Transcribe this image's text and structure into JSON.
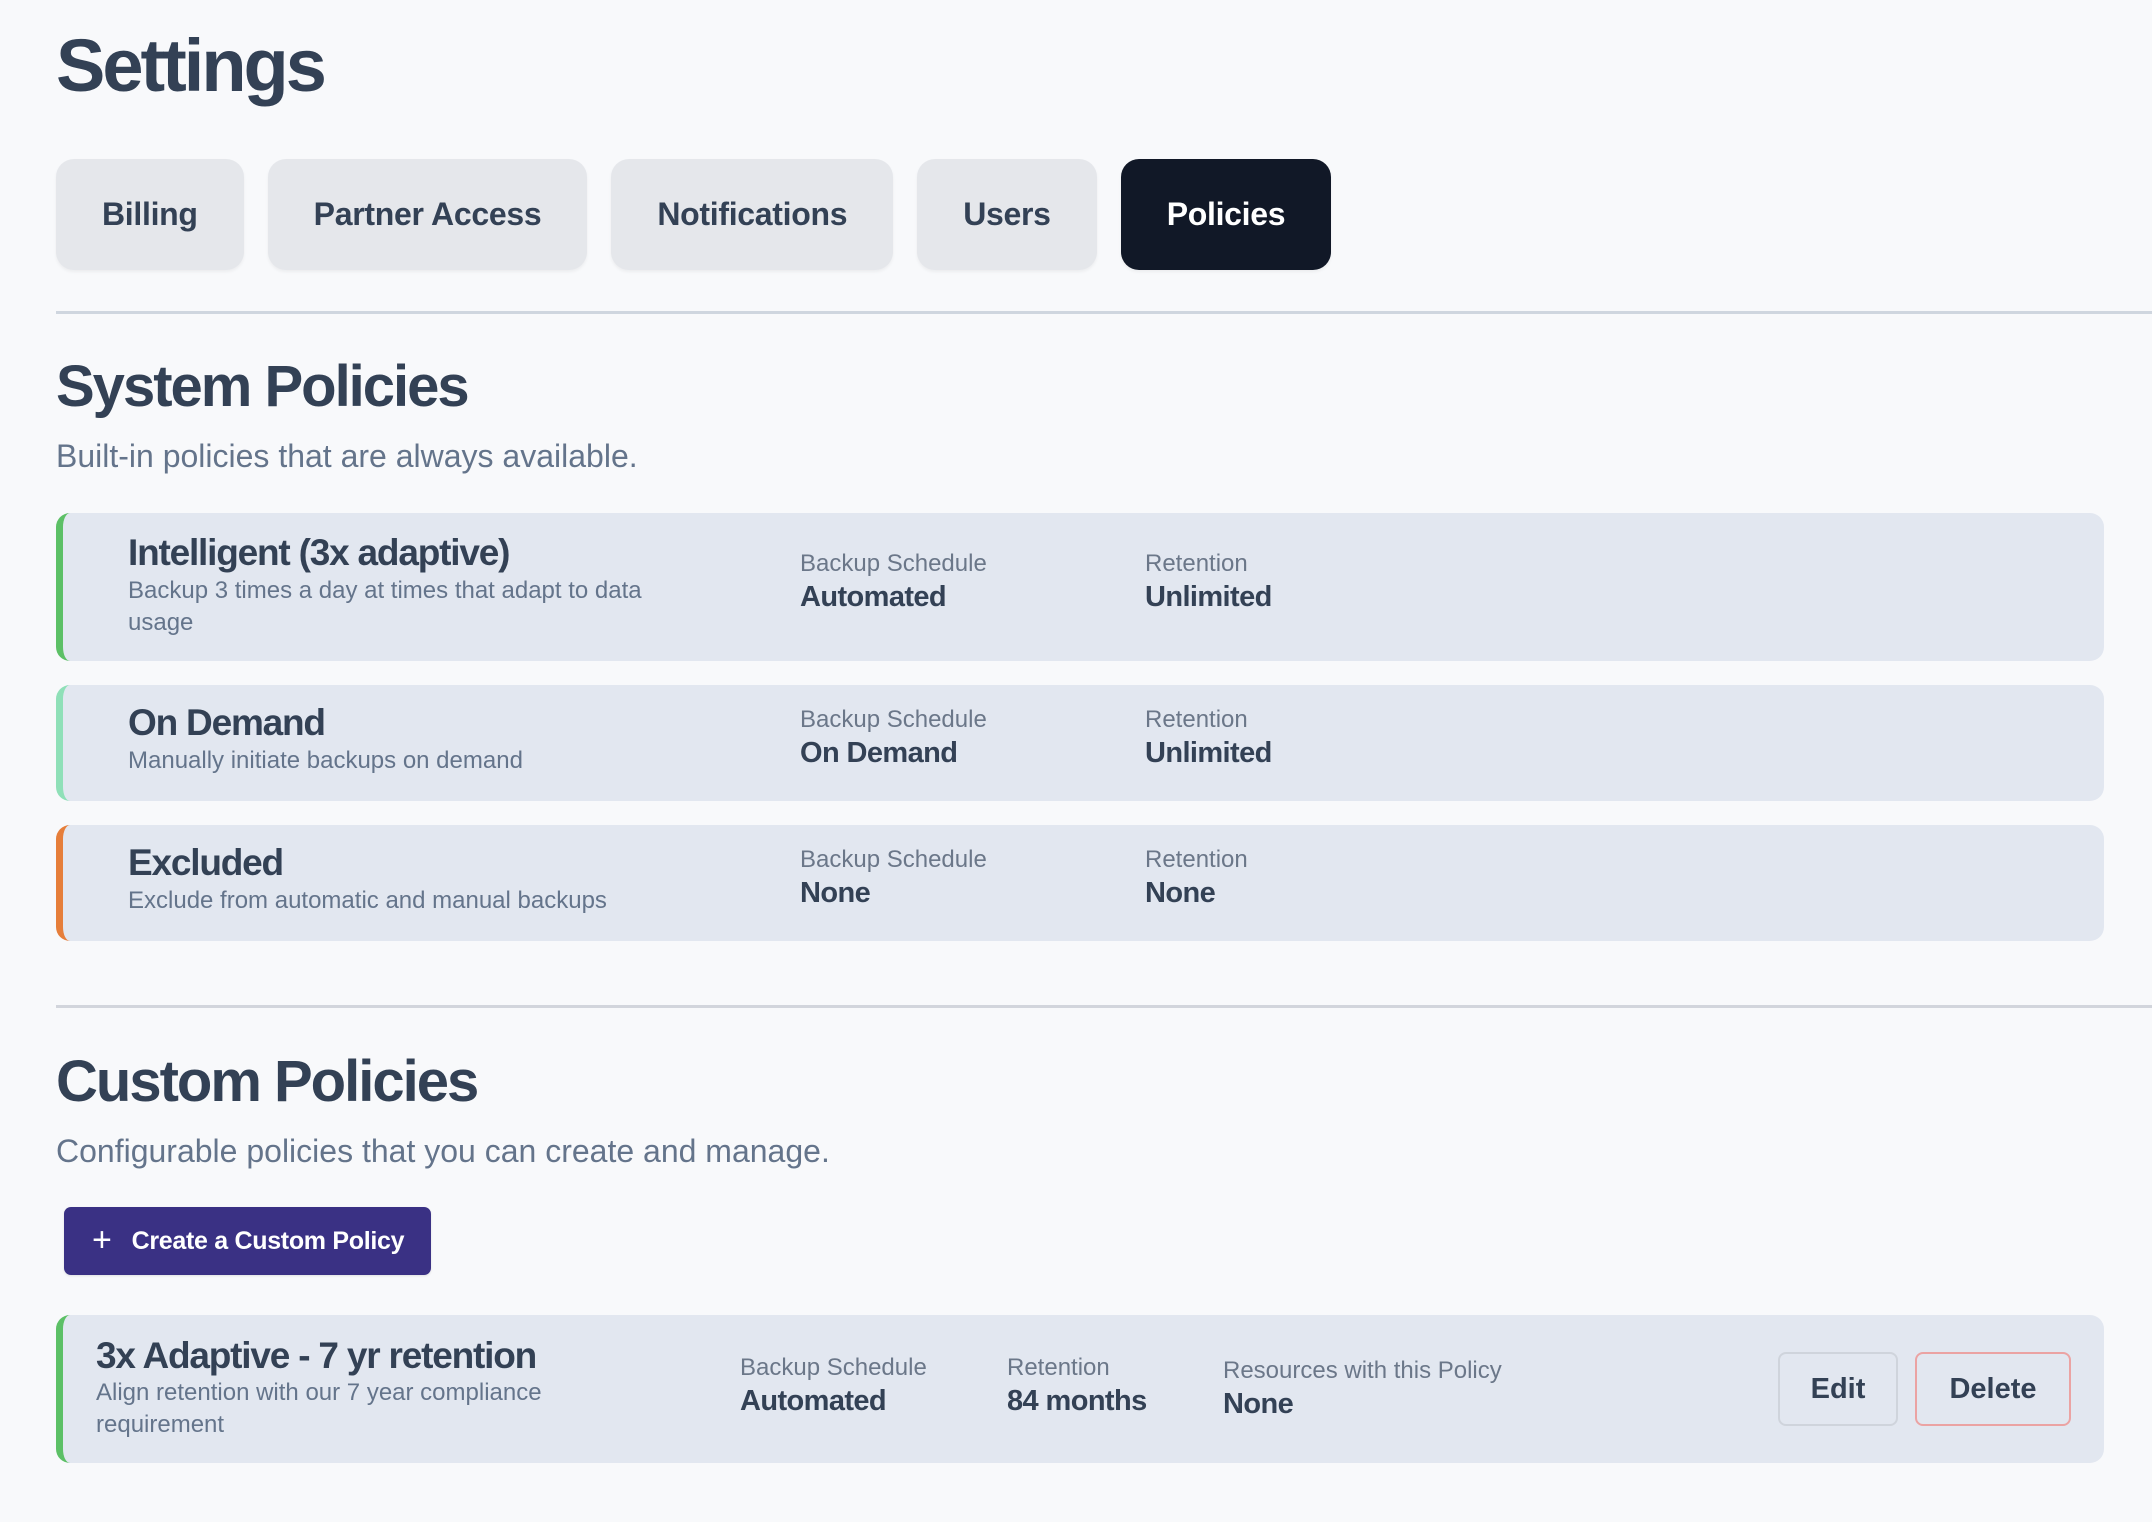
{
  "page": {
    "title": "Settings"
  },
  "tabs": [
    {
      "label": "Billing",
      "active": false
    },
    {
      "label": "Partner Access",
      "active": false
    },
    {
      "label": "Notifications",
      "active": false
    },
    {
      "label": "Users",
      "active": false
    },
    {
      "label": "Policies",
      "active": true
    }
  ],
  "system_policies": {
    "title": "System Policies",
    "subtitle": "Built-in policies that are always available.",
    "schedule_label": "Backup Schedule",
    "retention_label": "Retention",
    "items": [
      {
        "name": "Intelligent (3x adaptive)",
        "description": "Backup 3 times a day at times that adapt to data usage",
        "schedule": "Automated",
        "retention": "Unlimited",
        "accent_color": "#5cc066"
      },
      {
        "name": "On Demand",
        "description": "Manually initiate backups on demand",
        "schedule": "On Demand",
        "retention": "Unlimited",
        "accent_color": "#8fe0b8"
      },
      {
        "name": "Excluded",
        "description": "Exclude from automatic and manual backups",
        "schedule": "None",
        "retention": "None",
        "accent_color": "#e67e3a"
      }
    ]
  },
  "custom_policies": {
    "title": "Custom Policies",
    "subtitle": "Configurable policies that you can create and manage.",
    "create_button": {
      "icon": "plus-icon",
      "label": "Create a Custom Policy",
      "color": "#3a3184"
    },
    "schedule_label": "Backup Schedule",
    "retention_label": "Retention",
    "resources_label": "Resources with this Policy",
    "items": [
      {
        "name": "3x Adaptive - 7 yr retention",
        "description": "Align retention with our 7 year compliance requirement",
        "schedule": "Automated",
        "retention": "84 months",
        "resources": "None",
        "accent_color": "#5cc066",
        "edit_label": "Edit",
        "delete_label": "Delete"
      }
    ]
  },
  "colors": {
    "background": "#f8f9fb",
    "card": "#e2e7f0",
    "tab_inactive": "#e5e7eb",
    "tab_active": "#111827",
    "text_primary": "#334155",
    "text_muted": "#64748b",
    "delete_border": "#eba3a3"
  }
}
